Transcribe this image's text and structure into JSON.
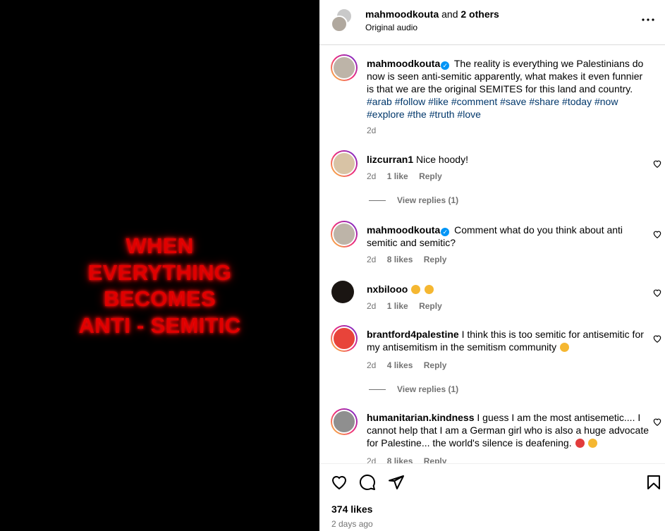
{
  "media": {
    "lines": [
      "WHEN",
      "EVERYTHING",
      "BECOMES",
      "ANTI - SEMITIC"
    ]
  },
  "header": {
    "username": "mahmoodkouta",
    "and": "and",
    "others": "2 others",
    "audio": "Original audio",
    "more_icon": "more-horizontal-icon"
  },
  "caption": {
    "username": "mahmoodkouta",
    "text": "The reality is everything we Palestinians do now is seen anti-semitic apparently, what makes it even funnier is that we are the original SEMITES for this land and country.",
    "tags": "#arab #follow #like #comment #save #share #today #now #explore #the #truth #love",
    "time": "2d"
  },
  "comments": [
    {
      "username": "lizcurran1",
      "text": "Nice hoody!",
      "time": "2d",
      "likes": "1 like",
      "reply": "Reply",
      "view_replies": "View replies (1)"
    },
    {
      "username": "mahmoodkouta",
      "text": "Comment what do you think about anti semitic and semitic?",
      "time": "2d",
      "likes": "8 likes",
      "reply": "Reply"
    },
    {
      "username": "nxbilooo",
      "text": "",
      "time": "2d",
      "likes": "1 like",
      "reply": "Reply"
    },
    {
      "username": "brantford4palestine",
      "text": "I think this is too semitic for antisemitic for my antisemitism in the semitism community",
      "time": "2d",
      "likes": "4 likes",
      "reply": "Reply",
      "view_replies": "View replies (1)"
    },
    {
      "username": "humanitarian.kindness",
      "text": "I guess I am the most antisemetic.... I cannot help that I am a German girl who is also a huge advocate for Palestine... the world's silence is deafening.",
      "time": "2d",
      "likes": "8 likes",
      "reply": "Reply"
    }
  ],
  "footer": {
    "likes": "374 likes",
    "date": "2 days ago",
    "icons": [
      "heart-icon",
      "comment-icon",
      "share-icon",
      "bookmark-icon"
    ]
  },
  "colors": {
    "accent": "#0095f6",
    "link": "#00376b",
    "media_text": "#e00000",
    "muted": "#737373"
  }
}
